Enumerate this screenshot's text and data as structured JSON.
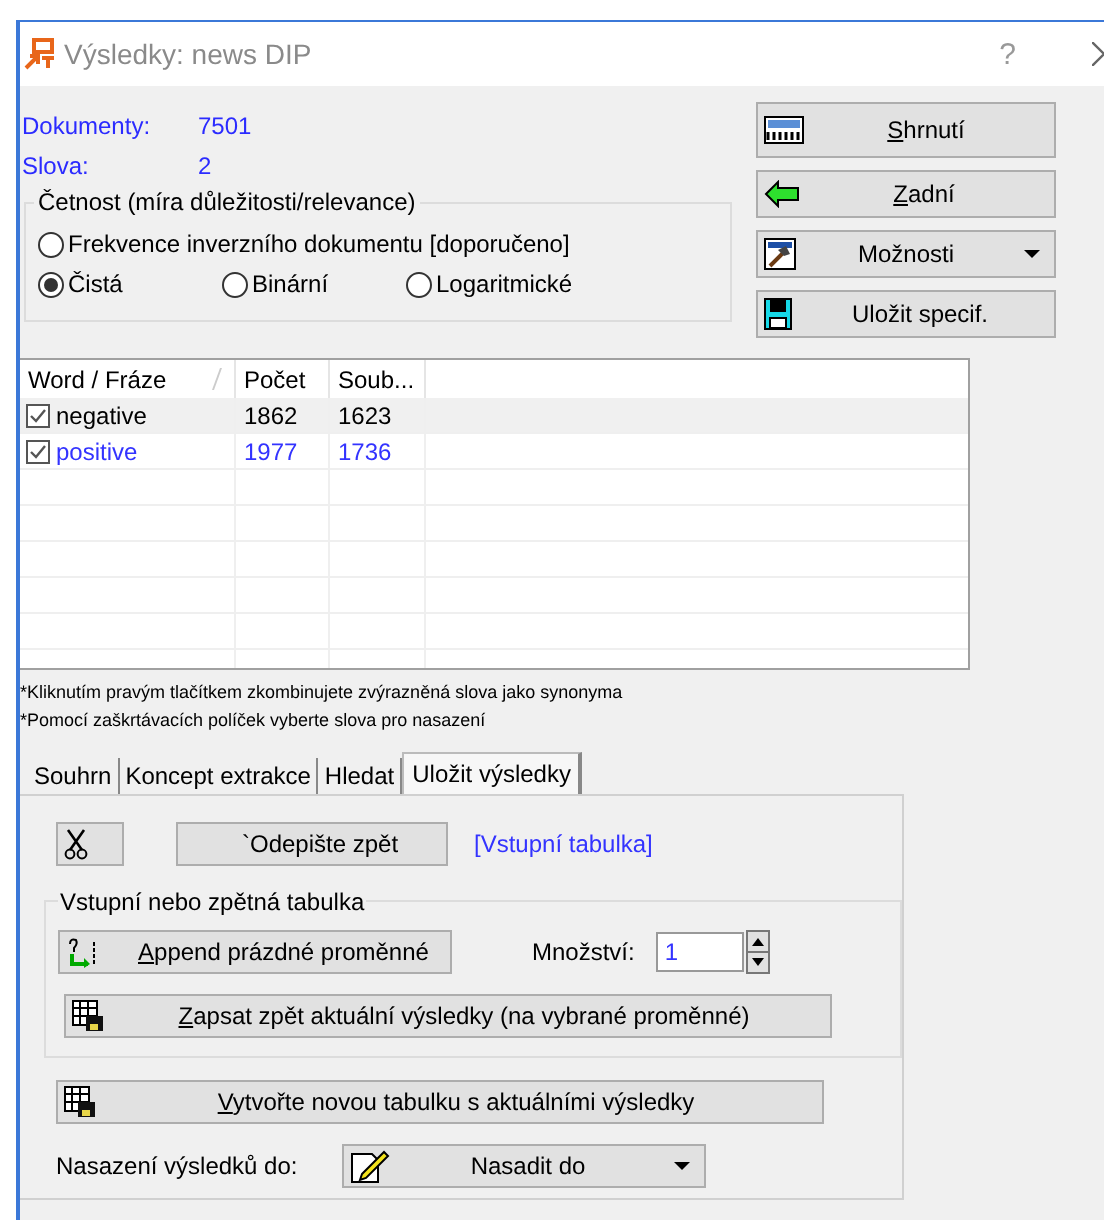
{
  "window": {
    "title": "Výsledky: news DIP",
    "help": "?"
  },
  "stats": [
    {
      "label": "Dokumenty:",
      "value": "7501"
    },
    {
      "label": "Slova:",
      "value": "2"
    }
  ],
  "frequency": {
    "title": "Četnost (míra důležitosti/relevance)",
    "options": [
      {
        "label": "Frekvence inverzního dokumentu  [doporučeno]",
        "selected": false
      },
      {
        "label": "Čistá",
        "selected": true
      },
      {
        "label": "Binární",
        "selected": false
      },
      {
        "label": "Logaritmické",
        "selected": false
      }
    ]
  },
  "actions": [
    {
      "kind": "summary",
      "label": "Shrnutí",
      "first_letter_underlined": true
    },
    {
      "kind": "back",
      "label": "Zadní",
      "first_letter_underlined": true
    },
    {
      "kind": "options",
      "label": "Možnosti",
      "dropdown": true
    },
    {
      "kind": "save",
      "label": "Uložit specif."
    }
  ],
  "table": {
    "columns": [
      "Word / Fráze",
      "Počet",
      "Soub..."
    ],
    "rows": [
      {
        "checked": true,
        "selected": true,
        "color": "#000000",
        "cells": [
          "negative",
          "1862",
          "1623"
        ]
      },
      {
        "checked": true,
        "selected": false,
        "color": "#3333ff",
        "cells": [
          "positive",
          "1977",
          "1736"
        ]
      }
    ]
  },
  "notes": [
    "*Kliknutím pravým tlačítkem zkombinujete zvýrazněná slova jako synonyma",
    "*Pomocí zaškrtávacích políček vyberte slova pro nasazení"
  ],
  "tabs": [
    {
      "label": "Souhrn",
      "selected": false
    },
    {
      "label": "Koncept extrakce",
      "selected": false
    },
    {
      "label": "Hledat",
      "selected": false
    },
    {
      "label": "Uložit výsledky",
      "selected": true
    }
  ],
  "panel": {
    "writeback": {
      "label": "`Odepište zpět",
      "link": "[Vstupní tabulka]"
    },
    "group": {
      "title": "Vstupní nebo zpětná tabulka",
      "append": {
        "label": "Append prázdné proměnné",
        "first_letter_underlined": true
      },
      "quantity_label": "Množství:",
      "quantity": "1",
      "write": {
        "label": "Zapsat zpět aktuální výsledky (na vybrané proměnné)",
        "first_letter_underlined": true
      }
    },
    "create": {
      "label": "Vytvořte novou tabulku s aktuálními výsledky",
      "first_letter_underlined": true
    },
    "deploy_label": "Nasazení výsledků do:",
    "deploy": {
      "label": "Nasadit do"
    }
  }
}
